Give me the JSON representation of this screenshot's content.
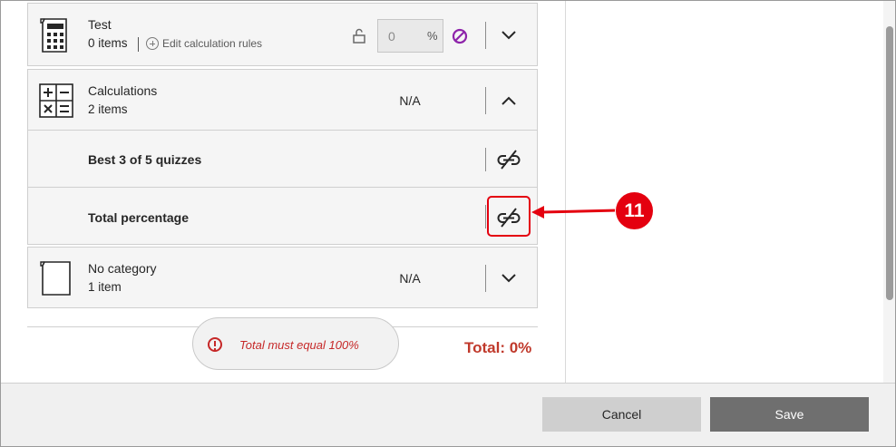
{
  "categories": [
    {
      "title": "Test",
      "count": "0 items",
      "edit_rules_label": "Edit calculation rules",
      "percent_value": "0",
      "percent_unit": "%"
    },
    {
      "title": "Calculations",
      "count": "2 items",
      "weight": "N/A",
      "children": [
        {
          "title": "Best 3 of 5 quizzes"
        },
        {
          "title": "Total percentage"
        }
      ]
    },
    {
      "title": "No category",
      "count": "1 item",
      "weight": "N/A"
    }
  ],
  "footer": {
    "error_message": "Total must equal 100%",
    "total_label": "Total: 0%"
  },
  "actions": {
    "cancel_label": "Cancel",
    "save_label": "Save"
  },
  "annotation": {
    "step_number": "11"
  },
  "colors": {
    "error": "#c62828",
    "callout": "#e4000f",
    "accent_purple": "#8e24aa",
    "save_button": "#6f6f6f",
    "cancel_button": "#cfcfcf"
  }
}
